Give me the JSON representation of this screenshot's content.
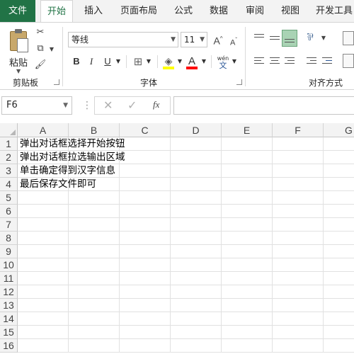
{
  "tabs": [
    {
      "label": "文件",
      "name": "tab-file"
    },
    {
      "label": "开始",
      "name": "tab-home",
      "active": true
    },
    {
      "label": "插入",
      "name": "tab-insert"
    },
    {
      "label": "页面布局",
      "name": "tab-page-layout"
    },
    {
      "label": "公式",
      "name": "tab-formulas"
    },
    {
      "label": "数据",
      "name": "tab-data"
    },
    {
      "label": "审阅",
      "name": "tab-review"
    },
    {
      "label": "视图",
      "name": "tab-view"
    },
    {
      "label": "开发工具",
      "name": "tab-developer"
    }
  ],
  "ribbon": {
    "clipboard": {
      "paste_label": "粘贴",
      "group_label": "剪贴板"
    },
    "font": {
      "font_name": "等线",
      "font_size": "11",
      "bold": "B",
      "italic": "I",
      "underline": "U",
      "group_label": "字体",
      "grow": "A",
      "shrink": "A",
      "font_color_letter": "A",
      "phonetic_top": "wén",
      "phonetic_bottom": "文"
    },
    "alignment": {
      "group_label": "对齐方式"
    }
  },
  "formula_bar": {
    "name_box": "F6",
    "fx": "fx",
    "formula": ""
  },
  "columns": [
    "A",
    "B",
    "C",
    "D",
    "E",
    "F",
    "G"
  ],
  "rows": [
    "1",
    "2",
    "3",
    "4",
    "5",
    "6",
    "7",
    "8",
    "9",
    "10",
    "11",
    "12",
    "13",
    "14",
    "15",
    "16"
  ],
  "cells": {
    "A1": "弹出对话框选择开始按钮",
    "A2": "弹出对话框拉选输出区域",
    "A3": "单击确定得到汉字信息",
    "A4": "最后保存文件即可"
  },
  "colors": {
    "accent": "#217346",
    "header_bg": "#f3f3f3",
    "highlight_yellow": "#ffff00",
    "font_red": "#ff0000"
  }
}
